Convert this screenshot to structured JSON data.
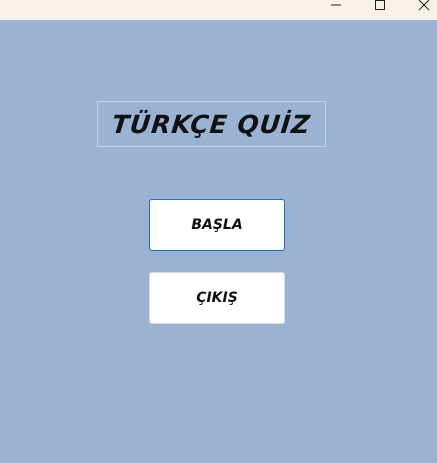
{
  "window": {
    "controls": {
      "minimize_icon": "minimize-icon",
      "maximize_icon": "maximize-icon",
      "close_icon": "close-icon"
    },
    "colors": {
      "background": "#9ab3d3",
      "titlebar": "#f8f1ea",
      "button_bg": "#ffffff",
      "focus_border": "#1a6fd0"
    }
  },
  "main": {
    "title": "TÜRKÇE QUİZ",
    "start_label": "BAŞLA",
    "exit_label": "ÇIKIŞ"
  }
}
